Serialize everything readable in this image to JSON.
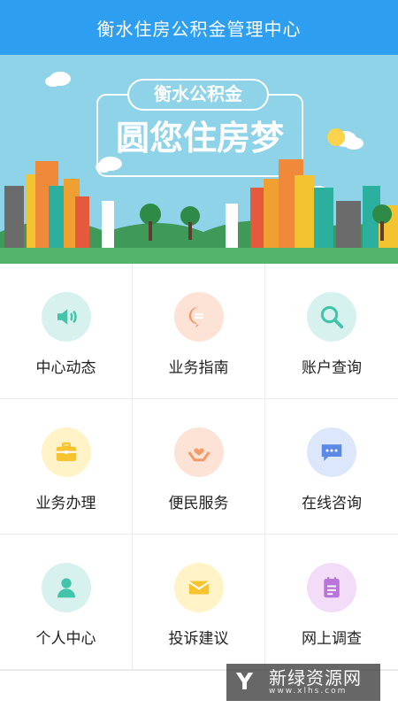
{
  "header": {
    "title": "衡水住房公积金管理中心"
  },
  "banner": {
    "tag": "衡水公积金",
    "slogan": "圆您住房梦"
  },
  "menu": [
    {
      "label": "中心动态",
      "icon": "speaker-icon",
      "bg": "#d7f1ee",
      "fg": "#41c4aa"
    },
    {
      "label": "业务指南",
      "icon": "chat-bubble-icon",
      "bg": "#fde2d6",
      "fg": "#f39b68"
    },
    {
      "label": "账户查询",
      "icon": "search-icon",
      "bg": "#d7f1ee",
      "fg": "#41c4aa"
    },
    {
      "label": "业务办理",
      "icon": "briefcase-icon",
      "bg": "#fff3c7",
      "fg": "#f7c430"
    },
    {
      "label": "便民服务",
      "icon": "heart-hands-icon",
      "bg": "#fde2d6",
      "fg": "#f39b68"
    },
    {
      "label": "在线咨询",
      "icon": "message-icon",
      "bg": "#dde7fb",
      "fg": "#5b8ae6"
    },
    {
      "label": "个人中心",
      "icon": "user-icon",
      "bg": "#d7f1ee",
      "fg": "#41c4aa"
    },
    {
      "label": "投诉建议",
      "icon": "mail-icon",
      "bg": "#fff3c7",
      "fg": "#f7c430"
    },
    {
      "label": "网上调查",
      "icon": "notepad-icon",
      "bg": "#f3dcf8",
      "fg": "#b975d9"
    }
  ],
  "watermark": {
    "text": "新绿资源网",
    "sub": "www.xlhs.com"
  },
  "colors": {
    "header": "#2d9ef0",
    "sky": "#8fd3e9"
  }
}
